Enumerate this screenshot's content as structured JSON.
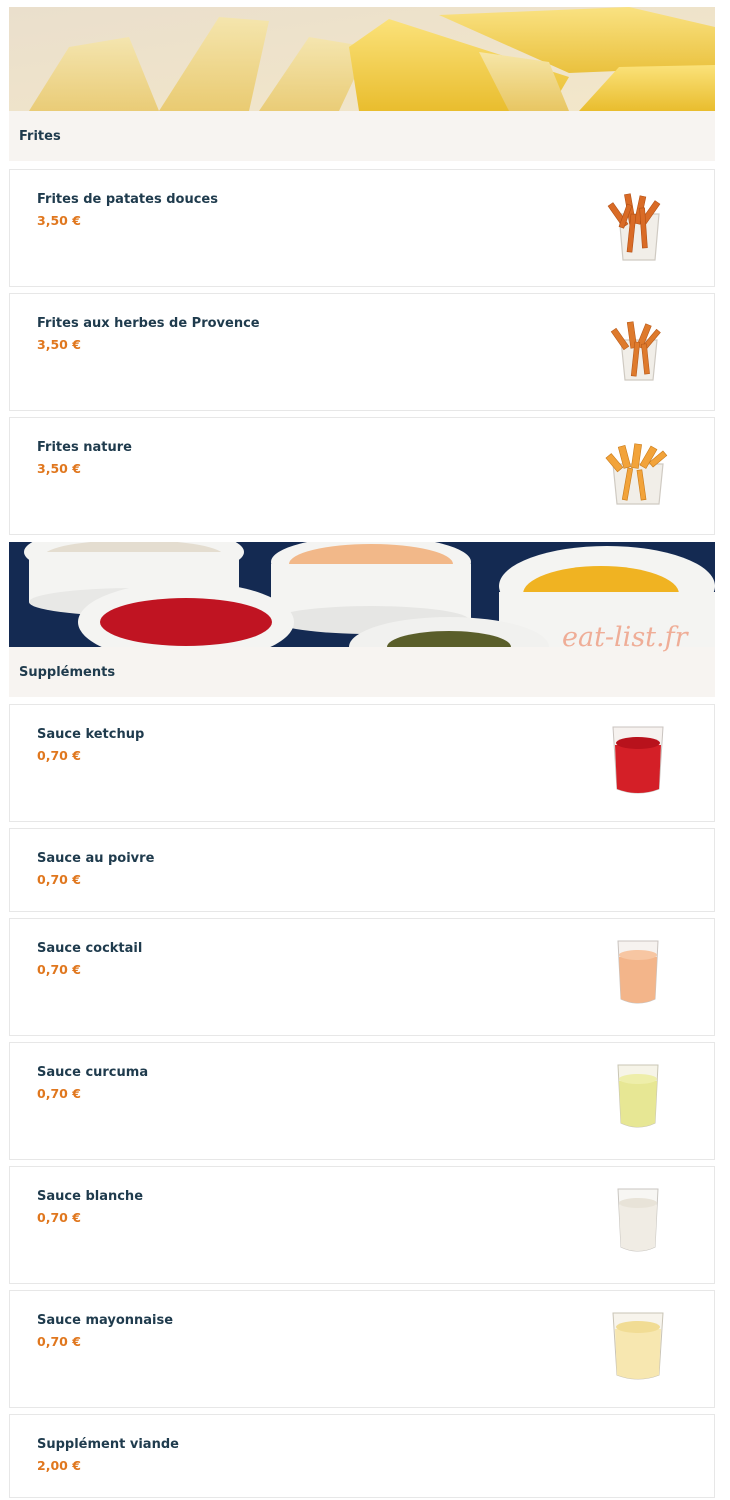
{
  "sections": [
    {
      "title": "Frites",
      "items": [
        {
          "name": "Frites de patates douces",
          "price": "3,50 €",
          "image": "sweet-potato-fries-cup"
        },
        {
          "name": "Frites aux herbes de Provence",
          "price": "3,50 €",
          "image": "herb-fries-cup"
        },
        {
          "name": "Frites nature",
          "price": "3,50 €",
          "image": "plain-fries-cup"
        }
      ]
    },
    {
      "title": "Suppléments",
      "items": [
        {
          "name": "Sauce ketchup",
          "price": "0,70 €",
          "image": "ketchup-cup"
        },
        {
          "name": "Sauce au poivre",
          "price": "0,70 €"
        },
        {
          "name": "Sauce cocktail",
          "price": "0,70 €",
          "image": "cocktail-sauce-cup"
        },
        {
          "name": "Sauce curcuma",
          "price": "0,70 €",
          "image": "curcuma-sauce-cup"
        },
        {
          "name": "Sauce blanche",
          "price": "0,70 €",
          "image": "white-sauce-cup"
        },
        {
          "name": "Sauce mayonnaise",
          "price": "0,70 €",
          "image": "mayonnaise-cup"
        },
        {
          "name": "Supplément viande",
          "price": "2,00 €"
        }
      ]
    }
  ],
  "watermark": "eat-list.fr",
  "colors": {
    "heading": "#1f3b4d",
    "price": "#e0771e",
    "header_bg": "#f7f4f1",
    "border": "#e7e7e7"
  }
}
